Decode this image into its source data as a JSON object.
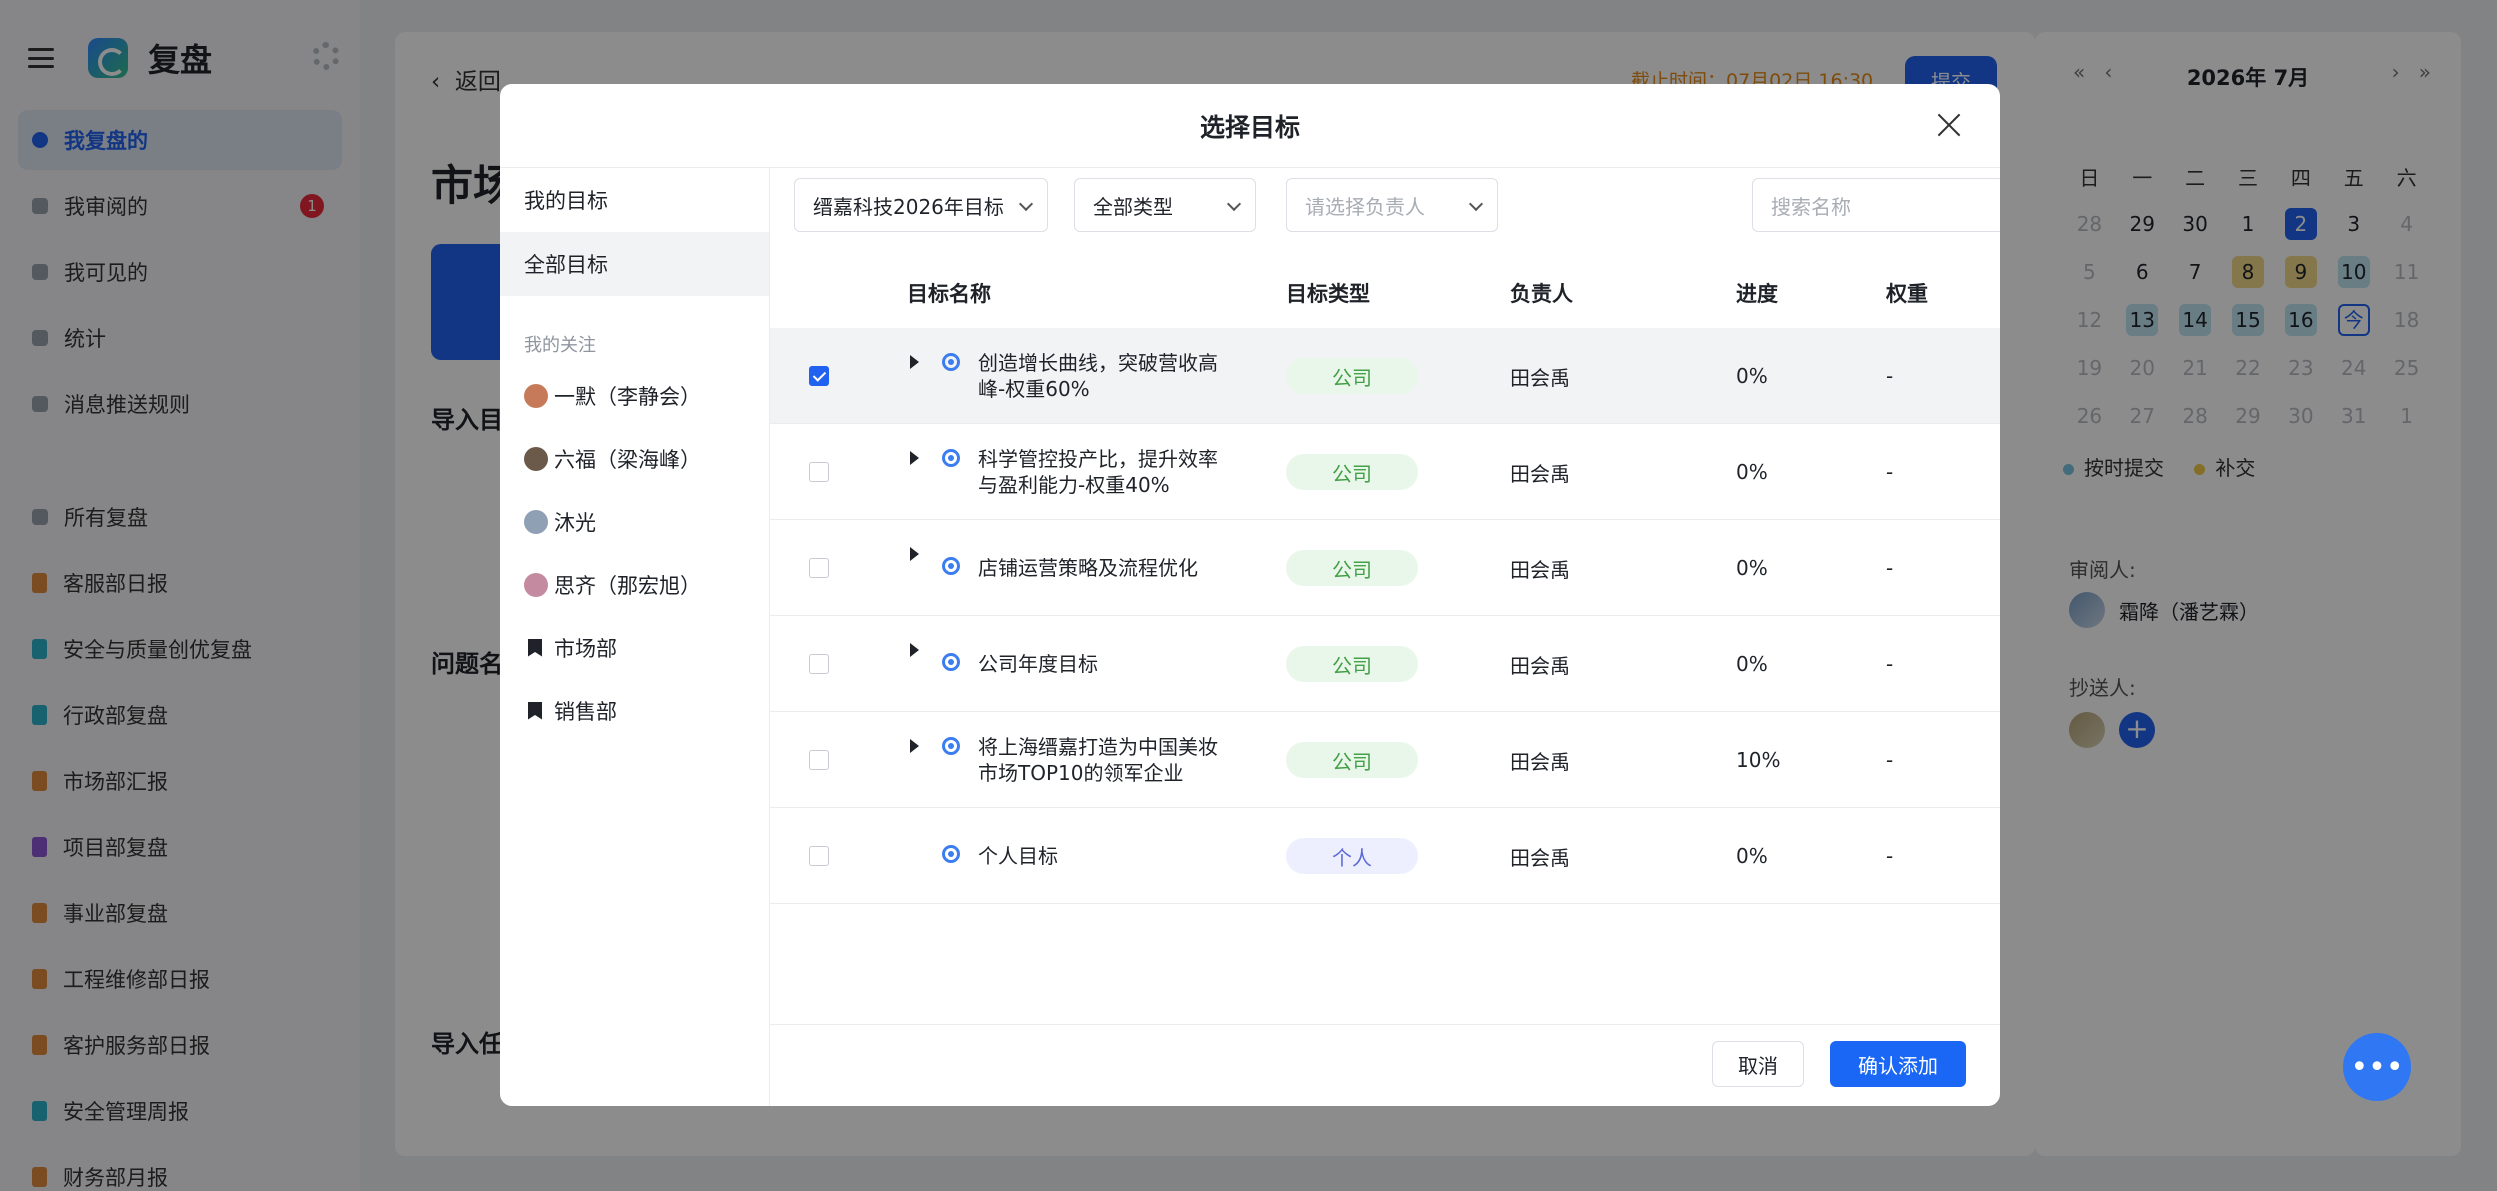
{
  "sidebar": {
    "title": "复盘",
    "items": [
      {
        "label": "我复盘的",
        "active": true
      },
      {
        "label": "我审阅的",
        "badge": "1"
      },
      {
        "label": "我可见的"
      },
      {
        "label": "统计"
      },
      {
        "label": "消息推送规则"
      }
    ],
    "groups": [
      {
        "label": "所有复盘"
      },
      {
        "label": "客服部日报",
        "color": "#e08a3c"
      },
      {
        "label": "安全与质量创优复盘",
        "color": "#2bb3c9"
      },
      {
        "label": "行政部复盘",
        "color": "#2bb3c9"
      },
      {
        "label": "市场部汇报",
        "color": "#e08a3c"
      },
      {
        "label": "项目部复盘",
        "color": "#8a56d6"
      },
      {
        "label": "事业部复盘",
        "color": "#e08a3c"
      },
      {
        "label": "工程维修部日报",
        "color": "#e08a3c"
      },
      {
        "label": "客护服务部日报",
        "color": "#e08a3c"
      },
      {
        "label": "安全管理周报",
        "color": "#2bb3c9"
      },
      {
        "label": "财务部月报",
        "color": "#e08a3c"
      }
    ]
  },
  "main": {
    "back_label": "返回",
    "deadline": "截止时间：07月02日 16:30",
    "submit_label": "提交",
    "title_fragment": "市场",
    "import_goal_fragment": "导入目",
    "problem_fragment": "问题名",
    "import_task_fragment": "导入任"
  },
  "calendar": {
    "title": "2026年 7月",
    "prev_year": "«",
    "prev_month": "‹",
    "next_month": "›",
    "next_year": "»",
    "weekdays": [
      "日",
      "一",
      "二",
      "三",
      "四",
      "五",
      "六"
    ],
    "weeks": [
      [
        {
          "d": "28",
          "m": true
        },
        {
          "d": "29"
        },
        {
          "d": "30"
        },
        {
          "d": "1"
        },
        {
          "d": "2",
          "bg": "#2163f0",
          "fg": "#ffffff"
        },
        {
          "d": "3"
        },
        {
          "d": "4",
          "m": true
        }
      ],
      [
        {
          "d": "5",
          "m": true
        },
        {
          "d": "6"
        },
        {
          "d": "7"
        },
        {
          "d": "8",
          "bg": "#f3d98a"
        },
        {
          "d": "9",
          "bg": "#f3d98a"
        },
        {
          "d": "10",
          "bg": "#bfe3f0"
        },
        {
          "d": "11",
          "m": true
        }
      ],
      [
        {
          "d": "12",
          "m": true
        },
        {
          "d": "13",
          "bg": "#bfe3f0"
        },
        {
          "d": "14",
          "bg": "#bfe3f0"
        },
        {
          "d": "15",
          "bg": "#bfe3f0"
        },
        {
          "d": "16",
          "bg": "#bfe3f0"
        },
        {
          "d": "今",
          "outline": "#2163f0",
          "fg": "#2163f0"
        },
        {
          "d": "18",
          "m": true
        }
      ],
      [
        {
          "d": "19",
          "m": true
        },
        {
          "d": "20",
          "m": true
        },
        {
          "d": "21",
          "m": true
        },
        {
          "d": "22",
          "m": true
        },
        {
          "d": "23",
          "m": true
        },
        {
          "d": "24",
          "m": true
        },
        {
          "d": "25",
          "m": true
        }
      ],
      [
        {
          "d": "26",
          "m": true
        },
        {
          "d": "27",
          "m": true
        },
        {
          "d": "28",
          "m": true
        },
        {
          "d": "29",
          "m": true
        },
        {
          "d": "30",
          "m": true
        },
        {
          "d": "31",
          "m": true
        },
        {
          "d": "1",
          "m": true
        }
      ]
    ],
    "legend": [
      {
        "label": "按时提交",
        "color": "#7cc3e0"
      },
      {
        "label": "补交",
        "color": "#f0c94a"
      }
    ],
    "reviewer_label": "审阅人:",
    "reviewer_name": "霜降（潘艺霖）",
    "cc_label": "抄送人:"
  },
  "modal": {
    "title": "选择目标",
    "left_nav": [
      {
        "label": "我的目标",
        "active": false
      },
      {
        "label": "全部目标",
        "active": true
      }
    ],
    "follow_section": "我的关注",
    "follows": [
      {
        "label": "一默（李静会）",
        "kind": "person",
        "color": "#c77a5a"
      },
      {
        "label": "六福（梁海峰）",
        "kind": "person",
        "color": "#6b5a4a"
      },
      {
        "label": "沐光",
        "kind": "person",
        "color": "#8fa0b5"
      },
      {
        "label": "思齐（那宏旭）",
        "kind": "person",
        "color": "#c48aa0"
      },
      {
        "label": "市场部",
        "kind": "dept"
      },
      {
        "label": "销售部",
        "kind": "dept"
      }
    ],
    "filters": {
      "goalset": "缙嘉科技2026年目标",
      "type": "全部类型",
      "owner_placeholder": "请选择负责人",
      "search_placeholder": "搜索名称"
    },
    "columns": [
      "目标名称",
      "目标类型",
      "负责人",
      "进度",
      "权重"
    ],
    "rows": [
      {
        "name": "创造增长曲线，突破营收高峰-权重60%",
        "type": "公司",
        "type_kind": "company",
        "owner": "田会禹",
        "progress": "0%",
        "weight": "-",
        "checked": true,
        "expandable": true
      },
      {
        "name": "科学管控投产比，提升效率与盈利能力-权重40%",
        "type": "公司",
        "type_kind": "company",
        "owner": "田会禹",
        "progress": "0%",
        "weight": "-",
        "checked": false,
        "expandable": true
      },
      {
        "name": "店铺运营策略及流程优化",
        "type": "公司",
        "type_kind": "company",
        "owner": "田会禹",
        "progress": "0%",
        "weight": "-",
        "checked": false,
        "expandable": true
      },
      {
        "name": "公司年度目标",
        "type": "公司",
        "type_kind": "company",
        "owner": "田会禹",
        "progress": "0%",
        "weight": "-",
        "checked": false,
        "expandable": true
      },
      {
        "name": "将上海缙嘉打造为中国美妆市场TOP10的领军企业",
        "type": "公司",
        "type_kind": "company",
        "owner": "田会禹",
        "progress": "10%",
        "weight": "-",
        "checked": false,
        "expandable": true
      },
      {
        "name": "个人目标",
        "type": "个人",
        "type_kind": "personal",
        "owner": "田会禹",
        "progress": "0%",
        "weight": "-",
        "checked": false,
        "expandable": false
      }
    ],
    "cancel_label": "取消",
    "confirm_label": "确认添加"
  },
  "fab_label": "•••"
}
